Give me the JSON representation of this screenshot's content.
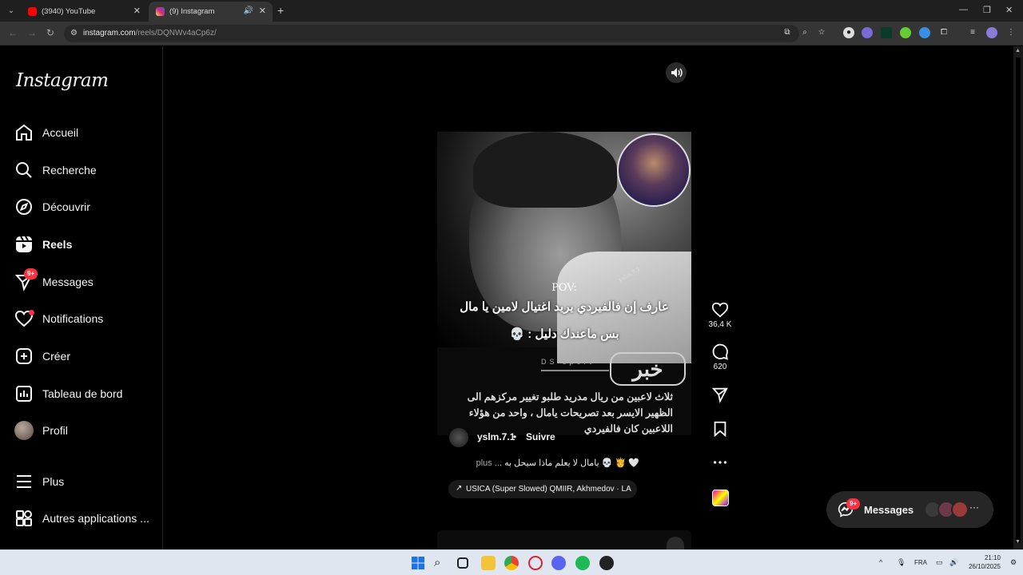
{
  "browser": {
    "tabs": [
      {
        "title": "(3940) YouTube",
        "active": false
      },
      {
        "title": "(9) Instagram",
        "active": true
      }
    ],
    "url_host": "instagram.com",
    "url_path": "/reels/DQNWv4aCp6z/"
  },
  "sidebar": {
    "logo": "Instagram",
    "items": [
      {
        "label": "Accueil",
        "icon": "home-icon"
      },
      {
        "label": "Recherche",
        "icon": "search-icon"
      },
      {
        "label": "Découvrir",
        "icon": "compass-icon"
      },
      {
        "label": "Reels",
        "icon": "reels-icon",
        "active": true
      },
      {
        "label": "Messages",
        "icon": "messenger-icon",
        "badge": "9+"
      },
      {
        "label": "Notifications",
        "icon": "heart-icon",
        "dot": true
      },
      {
        "label": "Créer",
        "icon": "plus-square-icon"
      },
      {
        "label": "Tableau de bord",
        "icon": "chart-icon"
      },
      {
        "label": "Profil",
        "icon": "avatar"
      },
      {
        "label": "Plus",
        "icon": "menu-icon"
      },
      {
        "label": "Autres applications ...",
        "icon": "apps-icon"
      }
    ]
  },
  "reel": {
    "watermark": "yslm.7.1",
    "pov": "POV:",
    "caption_line1": "عارف إن فالفيردي يريد اغتيال لامين يا مال",
    "caption_line2": "بس ماعندك دليل : 💀",
    "news_word": "خبر",
    "news_brand": "DS sport",
    "news_text": "ثلاث لاعبين من ريال مدريد طلبو تغيير مركزهم الى الظهير الايسر بعد تصريحات يامال ، واحد من هؤلاء اللاعبين كان فالفيردي",
    "author": "yslm.7.1",
    "separator": "•",
    "follow": "Suivre",
    "caption": "يامال لا يعلم ماذا سيحل به 💀 🫅 🤍",
    "caption_more": "plus ...",
    "music": "USICA (Super Slowed)  QMIIR, Akhmedov · LA"
  },
  "actions": {
    "likes": "36,4 K",
    "comments": "620"
  },
  "messages_widget": {
    "label": "Messages",
    "badge": "9+"
  },
  "taskbar": {
    "lang": "FRA",
    "time": "21:10",
    "date": "26/10/2025"
  },
  "colors": {
    "accent_red": "#ff3040",
    "background": "#000000",
    "taskbar": "#dfe6ef"
  }
}
